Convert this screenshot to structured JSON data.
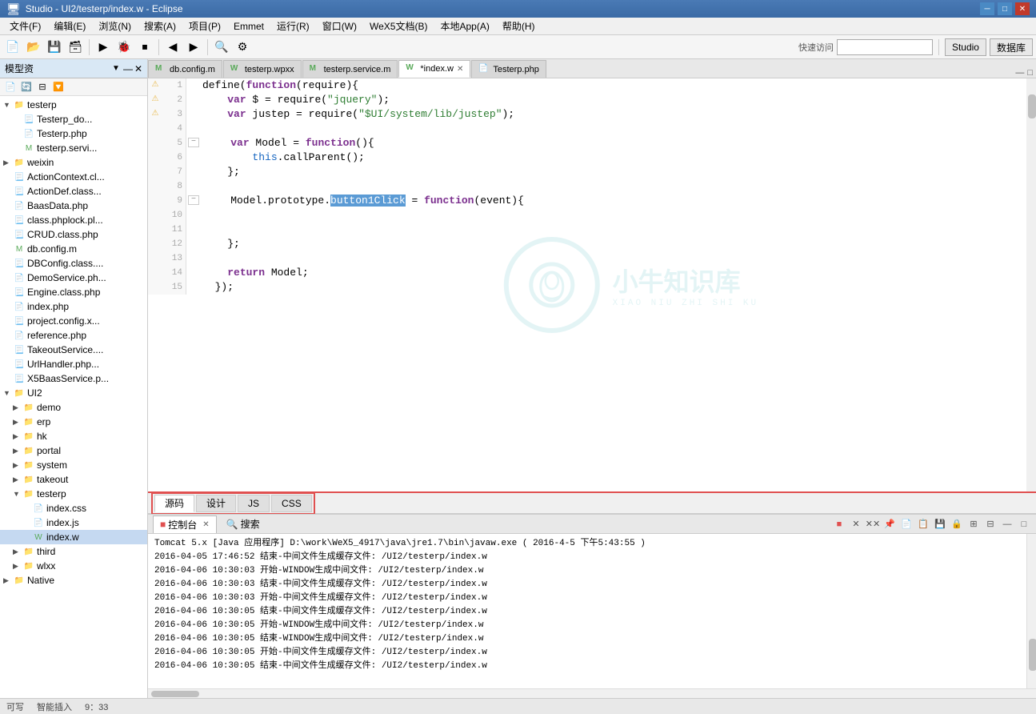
{
  "titlebar": {
    "title": "Studio - UI2/testerp/index.w - Eclipse",
    "minimize": "─",
    "maximize": "□",
    "close": "✕"
  },
  "menubar": {
    "items": [
      "文件(F)",
      "编辑(E)",
      "浏览(N)",
      "搜索(A)",
      "项目(P)",
      "Emmet",
      "运行(R)",
      "窗口(W)",
      "WeX5文档(B)",
      "本地App(A)",
      "帮助(H)"
    ]
  },
  "toolbar": {
    "quick_access_label": "快速访问",
    "studio_btn": "Studio",
    "database_btn": "数据库"
  },
  "left_panel": {
    "title": "模型资",
    "tree": [
      {
        "level": 0,
        "type": "folder",
        "label": "testerp",
        "expanded": true
      },
      {
        "level": 1,
        "type": "file-gen",
        "label": "Testerp_do..."
      },
      {
        "level": 1,
        "type": "file-php",
        "label": "Testerp.php"
      },
      {
        "level": 1,
        "type": "file-m",
        "label": "testerp.servi..."
      },
      {
        "level": 0,
        "type": "folder",
        "label": "weixin",
        "expanded": false
      },
      {
        "level": 0,
        "type": "file-gen",
        "label": "ActionContext.cl..."
      },
      {
        "level": 0,
        "type": "file-gen",
        "label": "ActionDef.class..."
      },
      {
        "level": 0,
        "type": "file-php",
        "label": "BaasData.php"
      },
      {
        "level": 0,
        "type": "file-gen",
        "label": "class.phplock.pl..."
      },
      {
        "level": 0,
        "type": "file-gen",
        "label": "CRUD.class.php"
      },
      {
        "level": 0,
        "type": "file-m",
        "label": "db.config.m"
      },
      {
        "level": 0,
        "type": "file-gen",
        "label": "DBConfig.class...."
      },
      {
        "level": 0,
        "type": "file-php",
        "label": "DemoService.ph..."
      },
      {
        "level": 0,
        "type": "file-gen",
        "label": "Engine.class.php"
      },
      {
        "level": 0,
        "type": "file-php",
        "label": "index.php"
      },
      {
        "level": 0,
        "type": "file-gen",
        "label": "project.config.x..."
      },
      {
        "level": 0,
        "type": "file-php",
        "label": "reference.php"
      },
      {
        "level": 0,
        "type": "file-gen",
        "label": "TakeoutService...."
      },
      {
        "level": 0,
        "type": "file-gen",
        "label": "UrlHandler.php..."
      },
      {
        "level": 0,
        "type": "file-gen",
        "label": "X5BaasService.p..."
      },
      {
        "level": 0,
        "type": "folder-root",
        "label": "UI2",
        "expanded": true
      },
      {
        "level": 1,
        "type": "folder",
        "label": "demo",
        "expanded": false
      },
      {
        "level": 1,
        "type": "folder",
        "label": "erp",
        "expanded": false
      },
      {
        "level": 1,
        "type": "folder",
        "label": "hk",
        "expanded": false
      },
      {
        "level": 1,
        "type": "folder",
        "label": "portal",
        "expanded": false
      },
      {
        "level": 1,
        "type": "folder",
        "label": "system",
        "expanded": false
      },
      {
        "level": 1,
        "type": "folder",
        "label": "takeout",
        "expanded": false
      },
      {
        "level": 1,
        "type": "folder",
        "label": "testerp",
        "expanded": true
      },
      {
        "level": 2,
        "type": "file-css",
        "label": "index.css"
      },
      {
        "level": 2,
        "type": "file-js",
        "label": "index.js"
      },
      {
        "level": 2,
        "type": "file-w",
        "label": "index.w"
      },
      {
        "level": 1,
        "type": "folder",
        "label": "third",
        "expanded": false
      },
      {
        "level": 1,
        "type": "folder",
        "label": "wlxx",
        "expanded": false
      },
      {
        "level": 0,
        "type": "folder",
        "label": "Native",
        "expanded": false
      }
    ]
  },
  "tabs": [
    {
      "label": "db.config.m",
      "icon": "m",
      "active": false
    },
    {
      "label": "testerp.wpxx",
      "icon": "w",
      "active": false
    },
    {
      "label": "testerp.service.m",
      "icon": "m",
      "active": false
    },
    {
      "label": "*index.w",
      "icon": "w",
      "active": true
    },
    {
      "label": "Testerp.php",
      "icon": "php",
      "active": false
    }
  ],
  "code": {
    "lines": [
      {
        "num": 1,
        "marker": "warn",
        "fold": "",
        "content": "define(<span class='kw'>function</span>(require){"
      },
      {
        "num": 2,
        "marker": "warn",
        "fold": "",
        "content": "    <span class='kw'>var</span> $ = require(<span class='str'>\"jquery\"</span>);"
      },
      {
        "num": 3,
        "marker": "warn",
        "fold": "",
        "content": "    <span class='kw'>var</span> justep = require(<span class='str'>\"$UI/system/lib/justep\"</span>);"
      },
      {
        "num": 4,
        "marker": "",
        "fold": "",
        "content": ""
      },
      {
        "num": 5,
        "marker": "",
        "fold": "−",
        "content": "    <span class='kw'>var</span> Model = <span class='kw'>function</span>(){"
      },
      {
        "num": 6,
        "marker": "",
        "fold": "",
        "content": "        <span class='fn'>this</span>.callParent();"
      },
      {
        "num": 7,
        "marker": "",
        "fold": "",
        "content": "    };"
      },
      {
        "num": 8,
        "marker": "",
        "fold": "",
        "content": ""
      },
      {
        "num": 9,
        "marker": "",
        "fold": "−",
        "content": "    Model.prototype.<span class='highlight-sel'>button1Click</span> = <span class='kw'>function</span>(event){"
      },
      {
        "num": 10,
        "marker": "",
        "fold": "",
        "content": ""
      },
      {
        "num": 11,
        "marker": "",
        "fold": "",
        "content": ""
      },
      {
        "num": 12,
        "marker": "",
        "fold": "",
        "content": "    };"
      },
      {
        "num": 13,
        "marker": "",
        "fold": "",
        "content": ""
      },
      {
        "num": 14,
        "marker": "",
        "fold": "",
        "content": "    <span class='kw'>return</span> Model;"
      },
      {
        "num": 15,
        "marker": "",
        "fold": "",
        "content": "  });"
      }
    ]
  },
  "source_tabs": [
    {
      "label": "源码",
      "active": true
    },
    {
      "label": "设计",
      "active": false
    },
    {
      "label": "JS",
      "active": false
    },
    {
      "label": "CSS",
      "active": false
    }
  ],
  "console": {
    "tabs": [
      {
        "label": "控制台",
        "icon": "■",
        "active": true
      },
      {
        "label": "搜索",
        "icon": "🔍",
        "active": false
      }
    ],
    "title_line": "Tomcat 5.x [Java 应用程序] D:\\work\\WeX5_4917\\java\\jre1.7\\bin\\javaw.exe ( 2016-4-5 下午5:43:55 )",
    "log_lines": [
      "2016-04-05  17:46:52  结束-中间文件生成缓存文件: /UI2/testerp/index.w",
      "2016-04-06  10:30:03  开始-WINDOW生成中间文件: /UI2/testerp/index.w",
      "2016-04-06  10:30:03  结束-中间文件生成缓存文件: /UI2/testerp/index.w",
      "2016-04-06  10:30:03  开始-中间文件生成缓存文件: /UI2/testerp/index.w",
      "2016-04-06  10:30:05  结束-中间文件生成缓存文件: /UI2/testerp/index.w",
      "2016-04-06  10:30:05  开始-WINDOW生成中间文件: /UI2/testerp/index.w",
      "2016-04-06  10:30:05  结束-WINDOW生成中间文件: /UI2/testerp/index.w",
      "2016-04-06  10:30:05  开始-中间文件生成缓存文件: /UI2/testerp/index.w",
      "2016-04-06  10:30:05  结束-中间文件生成缓存文件: /UI2/testerp/index.w"
    ]
  },
  "statusbar": {
    "write_mode": "可写",
    "insert_mode": "智能插入",
    "position": "9：33"
  },
  "watermark": {
    "zh": "小牛知识库",
    "en": "XIAO NIU ZHI SHI KU"
  }
}
